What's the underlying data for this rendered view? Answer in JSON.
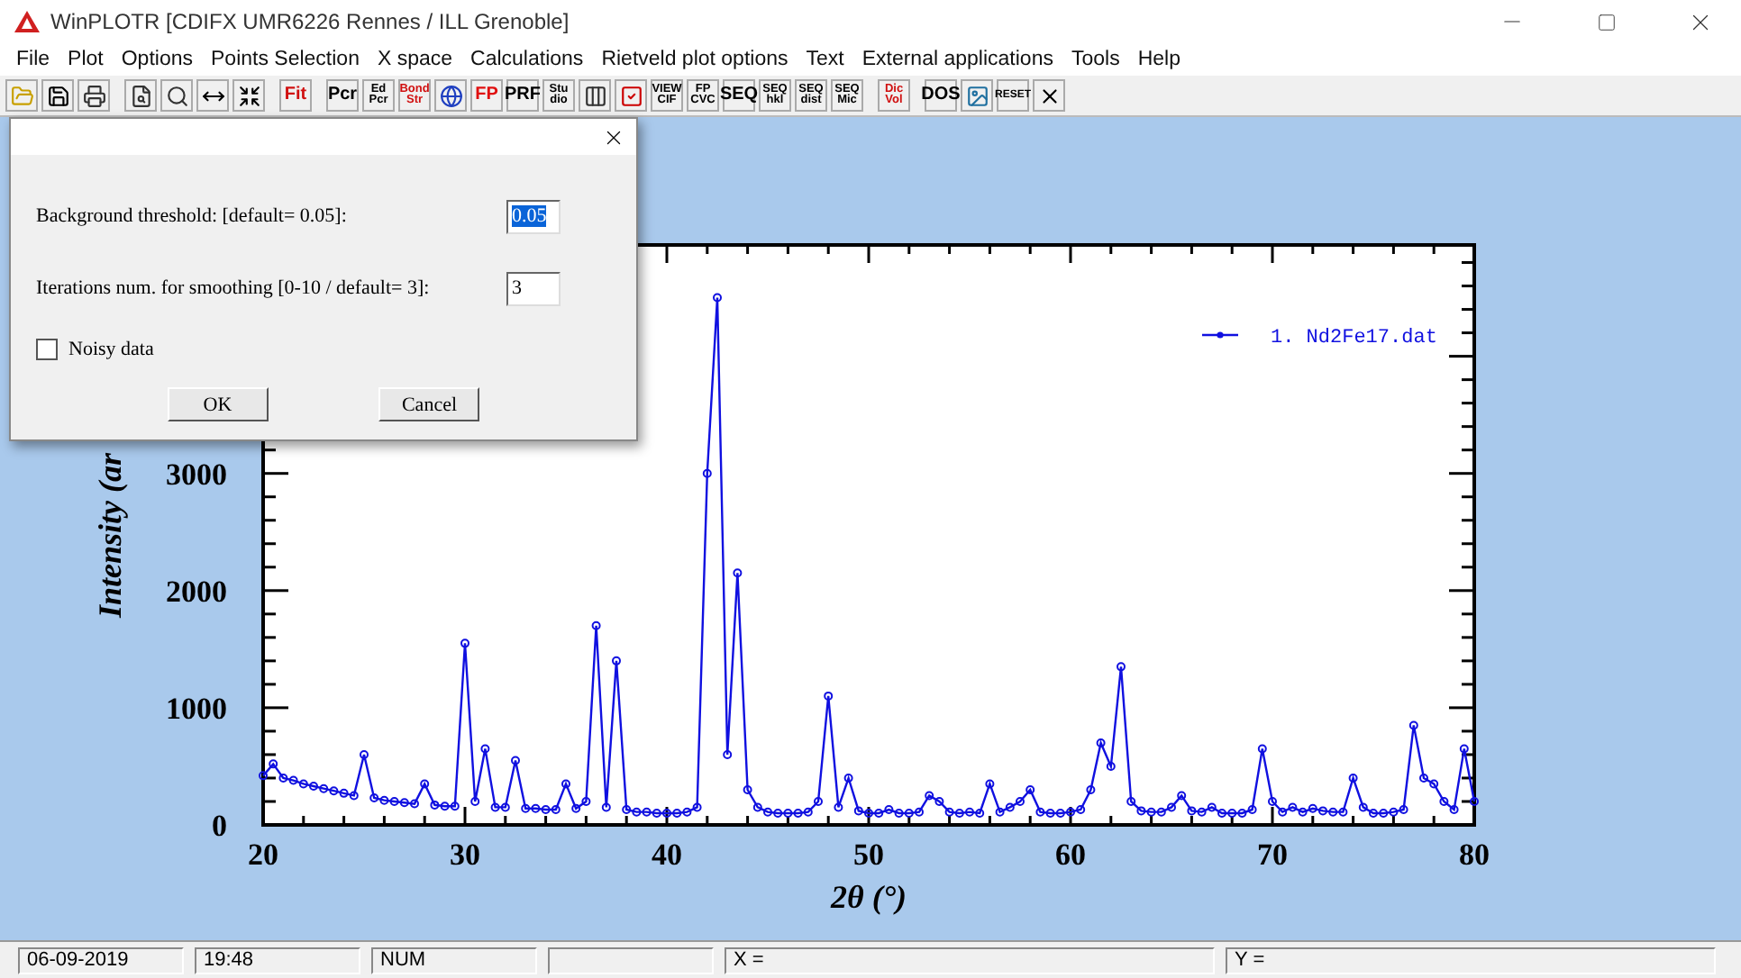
{
  "window": {
    "title": "WinPLOTR [CDIFX UMR6226 Rennes / ILL Grenoble]"
  },
  "menu": [
    "File",
    "Plot",
    "Options",
    "Points Selection",
    "X space",
    "Calculations",
    "Rietveld plot options",
    "Text",
    "External applications",
    "Tools",
    "Help"
  ],
  "toolbar": {
    "groups": [
      {
        "items": [
          {
            "kind": "icon"
          },
          {
            "kind": "icon"
          },
          {
            "kind": "icon"
          }
        ]
      },
      {
        "items": [
          {
            "kind": "icon"
          },
          {
            "kind": "icon"
          },
          {
            "kind": "icon"
          },
          {
            "kind": "icon"
          }
        ]
      },
      {
        "items": [
          {
            "kind": "text",
            "label": "Fit",
            "color": "#d01010"
          }
        ]
      },
      {
        "items": [
          {
            "kind": "text",
            "label": "Pcr",
            "color": "#000000"
          },
          {
            "kind": "text",
            "label": "Ed Pcr",
            "color": "#000000"
          },
          {
            "kind": "text",
            "label": "Bond Str",
            "color": "#d01010"
          },
          {
            "kind": "icon"
          },
          {
            "kind": "text",
            "label": "FP",
            "color": "#e01010"
          },
          {
            "kind": "text",
            "label": "PRF",
            "color": "#000000"
          },
          {
            "kind": "text",
            "label": "Stu dio",
            "color": "#000000"
          },
          {
            "kind": "icon"
          },
          {
            "kind": "icon"
          },
          {
            "kind": "text",
            "label": "VIEW CIF",
            "color": "#000000"
          },
          {
            "kind": "text",
            "label": "FP CVC",
            "color": "#000000"
          },
          {
            "kind": "text",
            "label": "SEQ",
            "color": "#000000"
          },
          {
            "kind": "text",
            "label": "SEQ hkl",
            "color": "#000000"
          },
          {
            "kind": "text",
            "label": "SEQ dist",
            "color": "#000000"
          },
          {
            "kind": "text",
            "label": "SEQ Mic",
            "color": "#000000"
          }
        ]
      },
      {
        "items": [
          {
            "kind": "text",
            "label": "Dic Vol",
            "color": "#d01010"
          }
        ]
      },
      {
        "items": [
          {
            "kind": "text",
            "label": "DOS",
            "color": "#000000"
          },
          {
            "kind": "icon"
          },
          {
            "kind": "text",
            "label": "RESET",
            "color": "#000000"
          },
          {
            "kind": "icon"
          }
        ]
      }
    ]
  },
  "plot": {
    "chart_data": {
      "type": "line",
      "xlabel": "2θ (°)",
      "ylabel": "Intensity (ar",
      "xlim": [
        20,
        80
      ],
      "ylim": [
        0,
        4950
      ],
      "xticks": [
        20,
        30,
        40,
        50,
        60,
        70,
        80
      ],
      "yticks": [
        0,
        1000,
        2000,
        3000
      ],
      "x": [
        20,
        20.5,
        21,
        21.5,
        22,
        22.5,
        23,
        23.5,
        24,
        24.5,
        25,
        25.5,
        26,
        26.5,
        27,
        27.5,
        28,
        28.5,
        29,
        29.5,
        30,
        30.5,
        31,
        31.5,
        32,
        32.5,
        33,
        33.5,
        34,
        34.5,
        35,
        35.5,
        36,
        36.5,
        37,
        37.5,
        38,
        38.5,
        39,
        39.5,
        40,
        40.5,
        41,
        41.5,
        42,
        42.5,
        43,
        43.5,
        44,
        44.5,
        45,
        45.5,
        46,
        46.5,
        47,
        47.5,
        48,
        48.5,
        49,
        49.5,
        50,
        50.5,
        51,
        51.5,
        52,
        52.5,
        53,
        53.5,
        54,
        54.5,
        55,
        55.5,
        56,
        56.5,
        57,
        57.5,
        58,
        58.5,
        59,
        59.5,
        60,
        60.5,
        61,
        61.5,
        62,
        62.5,
        63,
        63.5,
        64,
        64.5,
        65,
        65.5,
        66,
        66.5,
        67,
        67.5,
        68,
        68.5,
        69,
        69.5,
        70,
        70.5,
        71,
        71.5,
        72,
        72.5,
        73,
        73.5,
        74,
        74.5,
        75,
        75.5,
        76,
        76.5,
        77,
        77.5,
        78,
        78.5,
        79,
        79.5,
        80
      ],
      "series": [
        {
          "name": "1. Nd2Fe17.dat",
          "color": "#1010e0",
          "marker": "circle",
          "values": [
            420,
            520,
            400,
            380,
            350,
            330,
            310,
            290,
            270,
            250,
            600,
            230,
            210,
            200,
            190,
            180,
            350,
            170,
            160,
            160,
            1550,
            200,
            650,
            150,
            150,
            550,
            140,
            140,
            130,
            130,
            350,
            140,
            200,
            1700,
            150,
            1400,
            130,
            110,
            110,
            100,
            100,
            100,
            110,
            150,
            3000,
            4500,
            600,
            2150,
            300,
            150,
            110,
            100,
            100,
            100,
            110,
            200,
            1100,
            150,
            400,
            120,
            100,
            100,
            130,
            100,
            100,
            110,
            250,
            200,
            110,
            100,
            110,
            100,
            350,
            110,
            150,
            200,
            300,
            110,
            100,
            100,
            110,
            130,
            300,
            700,
            500,
            1350,
            200,
            120,
            110,
            110,
            150,
            250,
            120,
            110,
            150,
            100,
            100,
            100,
            130,
            650,
            200,
            110,
            150,
            110,
            140,
            120,
            110,
            110,
            400,
            150,
            100,
            100,
            110,
            130,
            850,
            400,
            350,
            200,
            130,
            650,
            200
          ]
        }
      ]
    }
  },
  "dialog": {
    "fields": [
      {
        "label": "Background threshold: [default= 0.05]:",
        "value": "0.05",
        "highlighted": true
      },
      {
        "label": "Iterations num. for smoothing [0-10 / default= 3]:",
        "value": "3",
        "highlighted": false
      }
    ],
    "checkbox": {
      "label": "Noisy data",
      "checked": false
    },
    "buttons": [
      "OK",
      "Cancel"
    ]
  },
  "status_bar": [
    {
      "kind": "text",
      "text": "06-09-2019"
    },
    {
      "kind": "text",
      "text": "19:48"
    },
    {
      "kind": "text",
      "text": "NUM"
    },
    {
      "kind": "empty"
    },
    {
      "kind": "text",
      "text": "X ="
    },
    {
      "kind": "text",
      "text": "Y ="
    }
  ]
}
